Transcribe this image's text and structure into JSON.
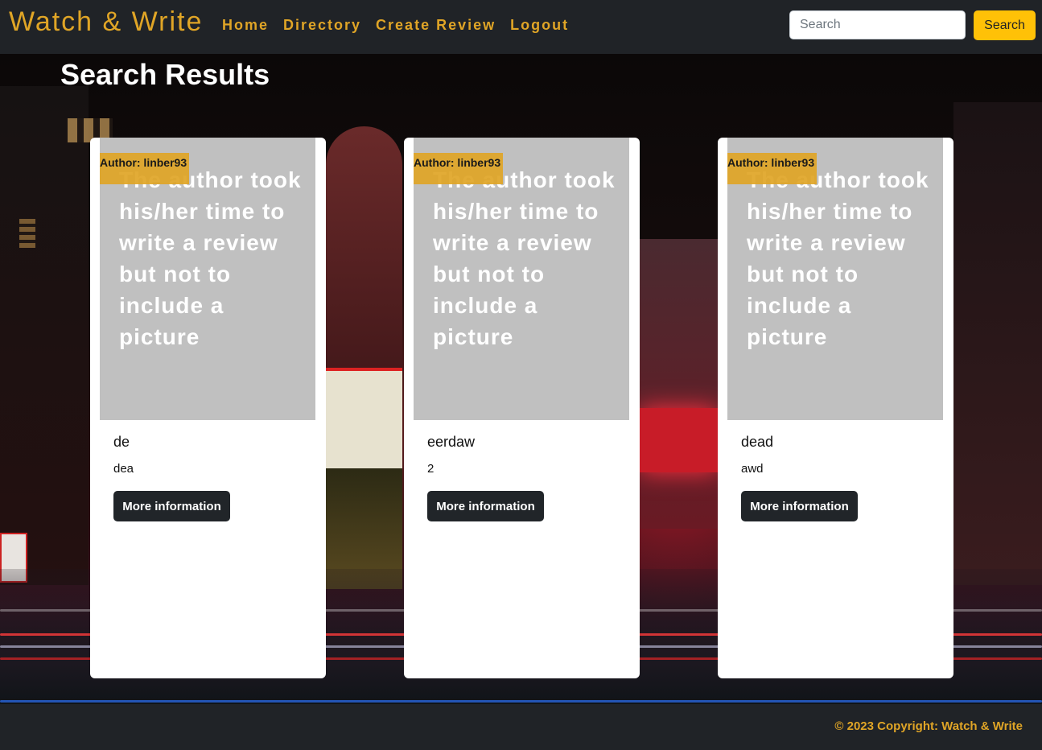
{
  "navbar": {
    "brand": "Watch & Write",
    "links": [
      "Home",
      "Directory",
      "Create Review",
      "Logout"
    ],
    "search_placeholder": "Search",
    "search_button": "Search"
  },
  "page": {
    "title": "Search Results"
  },
  "cards": [
    {
      "author": "Author: linber93",
      "image_alt": "The author took his/her time to write a review but not to include a picture",
      "title": "de",
      "text": "dea",
      "button": "More information"
    },
    {
      "author": "Author: linber93",
      "image_alt": "The author took his/her time to write a review but not to include a picture",
      "title": "eerdaw",
      "text": "2",
      "button": "More information"
    },
    {
      "author": "Author: linber93",
      "image_alt": "The author took his/her time to write a review but not to include a picture",
      "title": "dead",
      "text": "awd",
      "button": "More information"
    }
  ],
  "footer": {
    "copyright": "© 2023 Copyright: Watch & Write"
  },
  "colors": {
    "accent": "#e0a526",
    "navbar_bg": "#202327",
    "search_button_bg": "#ffc107",
    "card_bg": "#ffffff",
    "image_placeholder": "#c0c0c0",
    "button_dark": "#212529"
  }
}
